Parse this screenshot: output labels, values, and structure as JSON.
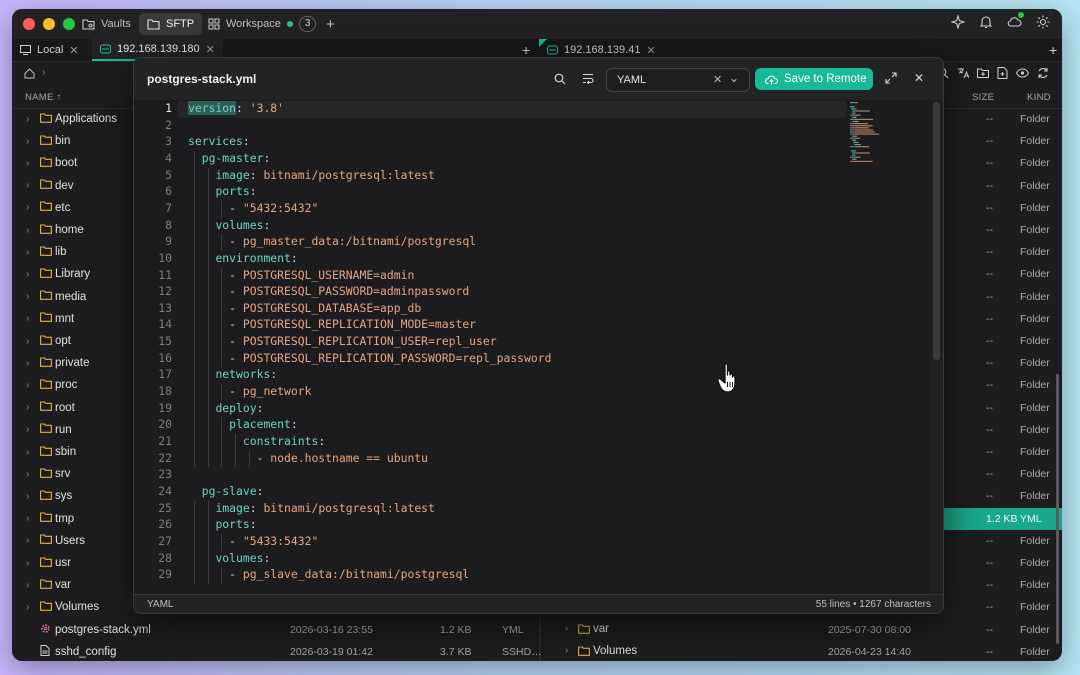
{
  "titlebar": {
    "tabs": [
      {
        "label": "Vaults",
        "icon": "vault-icon"
      },
      {
        "label": "SFTP",
        "icon": "folder-icon"
      },
      {
        "label": "Workspace",
        "icon": "grid-icon",
        "count": "3"
      }
    ],
    "icons": [
      "sparkle-icon",
      "bell-icon",
      "cloud-icon",
      "sun-icon"
    ]
  },
  "session_tabs": {
    "left": [
      {
        "label": "Local"
      },
      {
        "label": "192.168.139.180"
      }
    ],
    "right": [
      {
        "label": "192.168.139.41"
      }
    ]
  },
  "left_pane": {
    "headers": {
      "name": "NAME ↑",
      "size": "SIZE",
      "kind": "KIND"
    },
    "rows": [
      {
        "name": "Applications"
      },
      {
        "name": "bin"
      },
      {
        "name": "boot"
      },
      {
        "name": "dev"
      },
      {
        "name": "etc"
      },
      {
        "name": "home"
      },
      {
        "name": "lib"
      },
      {
        "name": "Library"
      },
      {
        "name": "media"
      },
      {
        "name": "mnt"
      },
      {
        "name": "opt"
      },
      {
        "name": "private"
      },
      {
        "name": "proc"
      },
      {
        "name": "root"
      },
      {
        "name": "run"
      },
      {
        "name": "sbin"
      },
      {
        "name": "srv"
      },
      {
        "name": "sys"
      },
      {
        "name": "tmp"
      },
      {
        "name": "Users"
      },
      {
        "name": "usr"
      },
      {
        "name": "var"
      },
      {
        "name": "Volumes"
      }
    ],
    "files": [
      {
        "name": "postgres-stack.yml",
        "date": "2026-03-16 23:55",
        "size": "1.2 KB",
        "kind": "YML"
      },
      {
        "name": "sshd_config",
        "date": "2026-03-19 01:42",
        "size": "3.7 KB",
        "kind": "SSHD_C..."
      }
    ]
  },
  "right_pane": {
    "headers": {
      "size": "SIZE",
      "kind": "KIND"
    },
    "rows": [
      {
        "size": "--",
        "kind": "Folder"
      },
      {
        "size": "--",
        "kind": "Folder"
      },
      {
        "size": "--",
        "kind": "Folder"
      },
      {
        "size": "--",
        "kind": "Folder"
      },
      {
        "size": "--",
        "kind": "Folder"
      },
      {
        "size": "--",
        "kind": "Folder"
      },
      {
        "size": "--",
        "kind": "Folder"
      },
      {
        "size": "--",
        "kind": "Folder"
      },
      {
        "size": "--",
        "kind": "Folder"
      },
      {
        "size": "--",
        "kind": "Folder"
      },
      {
        "size": "--",
        "kind": "Folder"
      },
      {
        "size": "--",
        "kind": "Folder"
      },
      {
        "size": "--",
        "kind": "Folder"
      },
      {
        "size": "--",
        "kind": "Folder"
      },
      {
        "size": "--",
        "kind": "Folder"
      },
      {
        "size": "--",
        "kind": "Folder"
      },
      {
        "size": "--",
        "kind": "Folder"
      },
      {
        "size": "--",
        "kind": "Folder"
      },
      {
        "size": "1.2 KB",
        "kind": "YML",
        "highlight": true
      },
      {
        "size": "--",
        "kind": "Folder"
      },
      {
        "size": "--",
        "kind": "Folder"
      },
      {
        "size": "--",
        "kind": "Folder"
      },
      {
        "size": "--",
        "kind": "Folder"
      },
      {
        "size": "--",
        "kind": "Folder"
      },
      {
        "size": "--",
        "kind": "Folder"
      }
    ],
    "visible_named": [
      {
        "name": "var",
        "date": "2025-07-30 08:00",
        "size": "--",
        "kind": "Folder"
      },
      {
        "name": "Volumes",
        "date": "2026-04-23 14:40",
        "size": "--",
        "kind": "Folder"
      }
    ]
  },
  "editor": {
    "filename": "postgres-stack.yml",
    "language": "YAML",
    "save_label": "Save to Remote",
    "footer_lang": "YAML",
    "stats": "55 lines • 1267 characters",
    "lines": [
      [
        [
          "k",
          "version"
        ],
        [
          "p",
          ": "
        ],
        [
          "s",
          "'3.8'"
        ]
      ],
      [],
      [
        [
          "k",
          "services"
        ],
        [
          "p",
          ":"
        ]
      ],
      [
        [
          "p",
          "  "
        ],
        [
          "k",
          "pg-master"
        ],
        [
          "p",
          ":"
        ]
      ],
      [
        [
          "p",
          "    "
        ],
        [
          "k",
          "image"
        ],
        [
          "p",
          ": "
        ],
        [
          "s",
          "bitnami/postgresql:latest"
        ]
      ],
      [
        [
          "p",
          "    "
        ],
        [
          "k",
          "ports"
        ],
        [
          "p",
          ":"
        ]
      ],
      [
        [
          "p",
          "      - "
        ],
        [
          "s",
          "\"5432:5432\""
        ]
      ],
      [
        [
          "p",
          "    "
        ],
        [
          "k",
          "volumes"
        ],
        [
          "p",
          ":"
        ]
      ],
      [
        [
          "p",
          "      - "
        ],
        [
          "s",
          "pg_master_data:/bitnami/postgresql"
        ]
      ],
      [
        [
          "p",
          "    "
        ],
        [
          "k",
          "environment"
        ],
        [
          "p",
          ":"
        ]
      ],
      [
        [
          "p",
          "      - "
        ],
        [
          "s",
          "POSTGRESQL_USERNAME=admin"
        ]
      ],
      [
        [
          "p",
          "      - "
        ],
        [
          "s",
          "POSTGRESQL_PASSWORD=adminpassword"
        ]
      ],
      [
        [
          "p",
          "      - "
        ],
        [
          "s",
          "POSTGRESQL_DATABASE=app_db"
        ]
      ],
      [
        [
          "p",
          "      - "
        ],
        [
          "s",
          "POSTGRESQL_REPLICATION_MODE=master"
        ]
      ],
      [
        [
          "p",
          "      - "
        ],
        [
          "s",
          "POSTGRESQL_REPLICATION_USER=repl_user"
        ]
      ],
      [
        [
          "p",
          "      - "
        ],
        [
          "s",
          "POSTGRESQL_REPLICATION_PASSWORD=repl_password"
        ]
      ],
      [
        [
          "p",
          "    "
        ],
        [
          "k",
          "networks"
        ],
        [
          "p",
          ":"
        ]
      ],
      [
        [
          "p",
          "      - "
        ],
        [
          "s",
          "pg_network"
        ]
      ],
      [
        [
          "p",
          "    "
        ],
        [
          "k",
          "deploy"
        ],
        [
          "p",
          ":"
        ]
      ],
      [
        [
          "p",
          "      "
        ],
        [
          "k",
          "placement"
        ],
        [
          "p",
          ":"
        ]
      ],
      [
        [
          "p",
          "        "
        ],
        [
          "k",
          "constraints"
        ],
        [
          "p",
          ":"
        ]
      ],
      [
        [
          "p",
          "          - "
        ],
        [
          "s",
          "node.hostname == ubuntu"
        ]
      ],
      [],
      [
        [
          "p",
          "  "
        ],
        [
          "k",
          "pg-slave"
        ],
        [
          "p",
          ":"
        ]
      ],
      [
        [
          "p",
          "    "
        ],
        [
          "k",
          "image"
        ],
        [
          "p",
          ": "
        ],
        [
          "s",
          "bitnami/postgresql:latest"
        ]
      ],
      [
        [
          "p",
          "    "
        ],
        [
          "k",
          "ports"
        ],
        [
          "p",
          ":"
        ]
      ],
      [
        [
          "p",
          "      - "
        ],
        [
          "s",
          "\"5433:5432\""
        ]
      ],
      [
        [
          "p",
          "    "
        ],
        [
          "k",
          "volumes"
        ],
        [
          "p",
          ":"
        ]
      ],
      [
        [
          "p",
          "      - "
        ],
        [
          "s",
          "pg_slave_data:/bitnami/postgresql"
        ]
      ]
    ]
  },
  "colors": {
    "accent": "#17b996",
    "background": "#1d1d1f",
    "key": "#6fd3c4",
    "string": "#e3a684"
  }
}
